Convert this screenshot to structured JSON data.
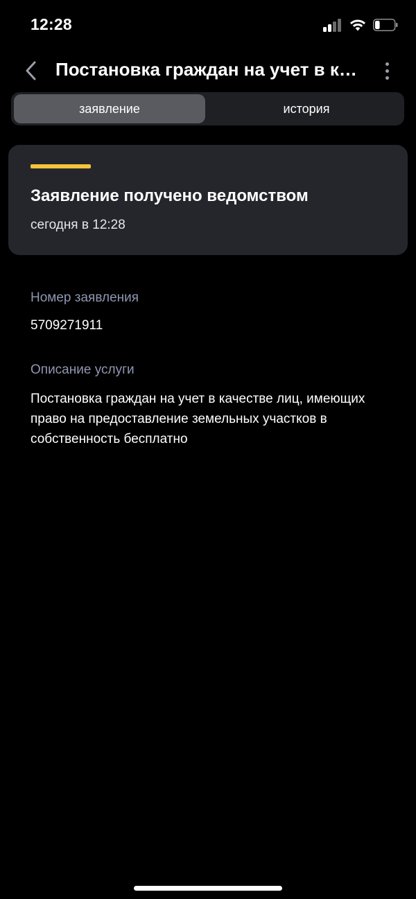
{
  "status_bar": {
    "time": "12:28",
    "icons": [
      "cellular-signal-icon",
      "wifi-icon",
      "battery-icon"
    ],
    "battery_level": 0.25
  },
  "header": {
    "title": "Постановка граждан на учет в качестве лиц, имеющих право на предоставление земельных участков в собственность бесплатно",
    "back_icon": "chevron-left-icon",
    "menu_icon": "more-vertical-icon"
  },
  "tabs": [
    {
      "label": "заявление",
      "active": true
    },
    {
      "label": "история",
      "active": false
    }
  ],
  "status_card": {
    "accent_color": "#f5c33b",
    "title": "Заявление получено ведомством",
    "time": "сегодня в 12:28"
  },
  "details": {
    "number_label": "Номер заявления",
    "number_value": "5709271911",
    "description_label": "Описание услуги",
    "description_value": "Постановка граждан на учет в качестве лиц, имеющих право на предоставление земельных участков в собственность бесплатно"
  },
  "colors": {
    "background": "#000000",
    "card": "#25262c",
    "segment_bg": "#1f2024",
    "segment_active": "#5a5b61",
    "label": "#8f96b0"
  }
}
